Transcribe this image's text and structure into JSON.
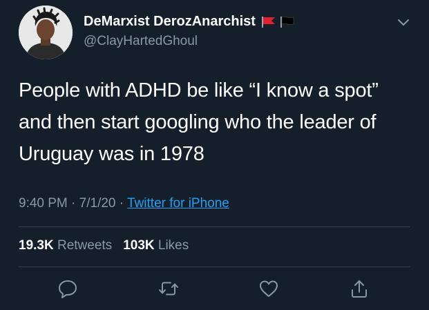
{
  "author": {
    "display_name": "DeMarxist DerozAnarchist",
    "handle": "@ClayHartedGhoul",
    "flag_colors": [
      "#e0212e",
      "#000000"
    ]
  },
  "tweet": {
    "text": "People with ADHD be like “I know a spot” and then start googling who the leader of Uruguay was in 1978",
    "time": "9:40 PM",
    "date": "7/1/20",
    "source": "Twitter for iPhone",
    "separator": "·"
  },
  "stats": {
    "retweets_count": "19.3K",
    "retweets_label": "Retweets",
    "likes_count": "103K",
    "likes_label": "Likes"
  },
  "actions": {
    "icons": [
      "reply-icon",
      "retweet-icon",
      "like-icon",
      "share-icon"
    ]
  },
  "colors": {
    "background": "#151f2b",
    "text": "#ffffff",
    "secondary_text": "#8899a6",
    "link": "#1da1f2",
    "divider": "#38444d"
  }
}
